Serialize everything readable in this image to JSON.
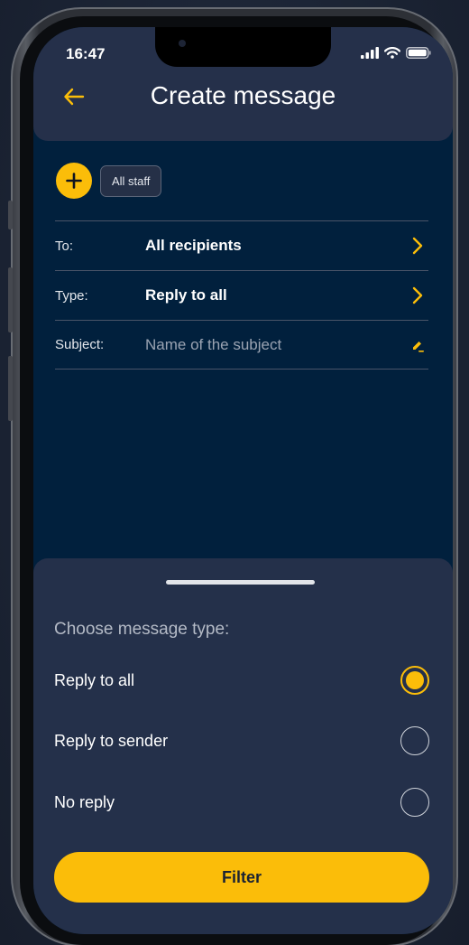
{
  "status_bar": {
    "time": "16:47"
  },
  "header": {
    "title": "Create message",
    "back_icon": "arrow-left-icon"
  },
  "chips": {
    "add_icon": "plus-icon",
    "items": [
      "All staff"
    ]
  },
  "form": {
    "to": {
      "label": "To:",
      "value": "All recipients",
      "icon": "chevron-right-icon"
    },
    "type": {
      "label": "Type:",
      "value": "Reply to all",
      "icon": "chevron-right-icon"
    },
    "subject": {
      "label": "Subject:",
      "placeholder": "Name of the subject",
      "icon": "pencil-icon"
    }
  },
  "sheet": {
    "title": "Choose message type:",
    "options": [
      {
        "label": "Reply to all",
        "selected": true
      },
      {
        "label": "Reply to sender",
        "selected": false
      },
      {
        "label": "No reply",
        "selected": false
      }
    ],
    "filter_label": "Filter"
  },
  "colors": {
    "accent": "#fbbd09",
    "screen_bg": "#01203d",
    "header_bg": "#25304a",
    "sheet_bg": "#24304a"
  }
}
